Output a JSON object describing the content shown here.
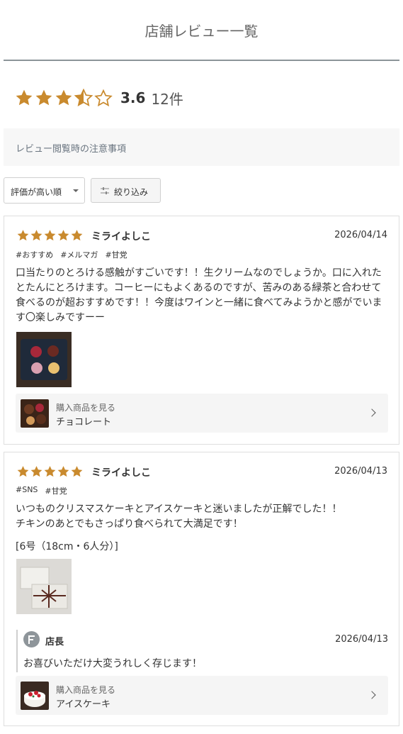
{
  "header": {
    "title": "店舗レビュー一覧"
  },
  "summary": {
    "average": "3.6",
    "count": "12件",
    "rating_value": 3.6,
    "star_color": "#c98a2e"
  },
  "notice": {
    "text": "レビュー閲覧時の注意事項"
  },
  "controls": {
    "sort_label": "評価が高い順",
    "filter_label": "絞り込み"
  },
  "reviews": [
    {
      "rating": 5,
      "name": "ミライよしこ",
      "date": "2026/04/14",
      "tags": [
        "#おすすめ",
        "#メルマガ",
        "#甘党"
      ],
      "body": "口当たりのとろける感触がすごいです！！生クリームなのでしょうか。口に入れたとたんにとろけます。コーヒーにもよくあるのですが、苦みのある緑茶と合わせて食べるのが超おすすめです！！今度はワインと一緒に食べてみようかと感がでいます〇楽しみですーー",
      "product_label": "購入商品を見る",
      "product_name": "チョコレート"
    },
    {
      "rating": 5,
      "name": "ミライよしこ",
      "date": "2026/04/13",
      "tags": [
        "#SNS",
        "#甘党"
      ],
      "body_line1": "いつものクリスマスケーキとアイスケーキと迷いましたが正解でした！！",
      "body_line2": "チキンのあとでもさっぱり食べられて大満足です！",
      "size": "[6号（18cm・6人分）]",
      "reply": {
        "name": "店長",
        "date": "2026/04/13",
        "text": "お喜びいただけ大変うれしく存じます！"
      },
      "product_label": "購入商品を見る",
      "product_name": "アイスケーキ"
    }
  ]
}
